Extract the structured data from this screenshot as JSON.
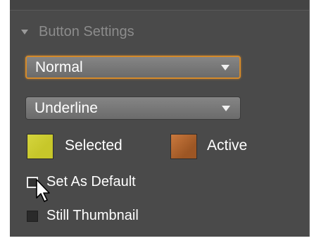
{
  "section": {
    "title": "Button Settings",
    "collapse_icon": "triangle-down-icon"
  },
  "dropdowns": {
    "style_value": "Normal",
    "decoration_value": "Underline"
  },
  "swatches": {
    "selected_label": "Selected",
    "selected_color": "#c7c72a",
    "active_label": "Active",
    "active_color": "#b8652a"
  },
  "checkboxes": {
    "set_as_default_label": "Set As Default",
    "set_as_default_checked": false,
    "still_thumbnail_label": "Still Thumbnail",
    "still_thumbnail_checked": false
  },
  "colors": {
    "panel_bg": "#4a4a4a",
    "focus_accent": "#d48a2a",
    "header_text": "#8c8c8c"
  },
  "cursor": {
    "icon": "mouse-pointer-icon"
  }
}
